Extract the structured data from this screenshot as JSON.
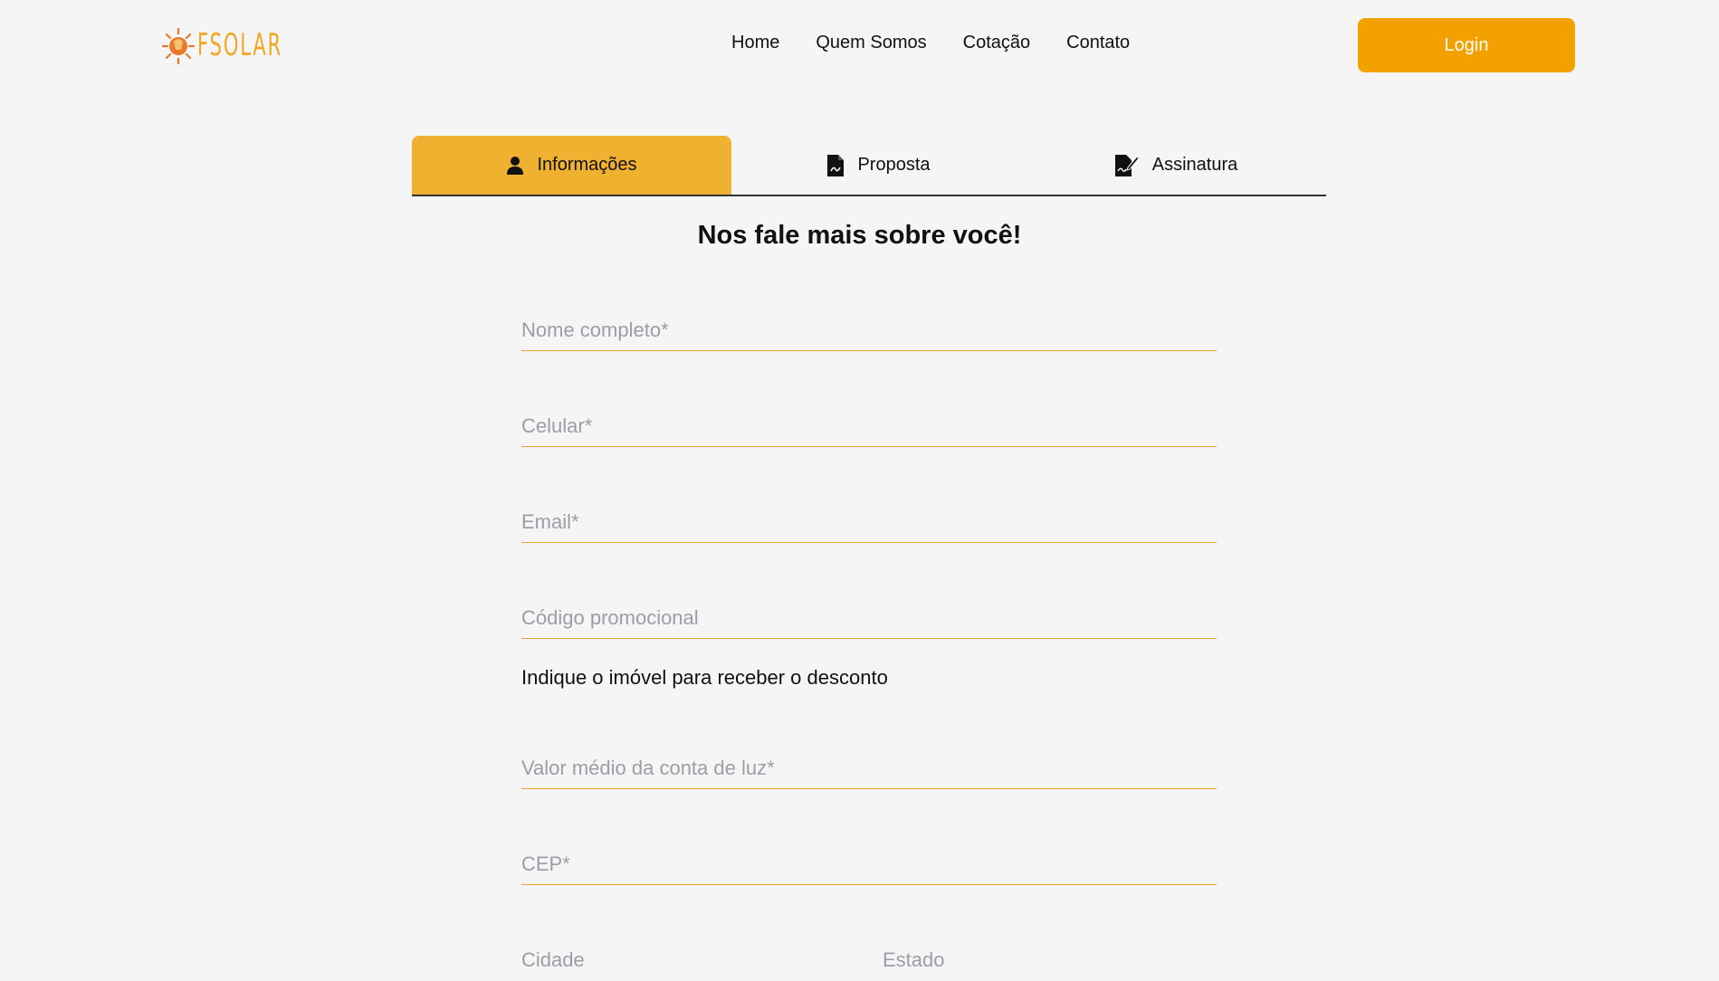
{
  "brand": {
    "logo_text": "FSOLAR",
    "accent_color": "#f2a100",
    "tab_active_color": "#f0b030"
  },
  "nav": {
    "items": [
      "Home",
      "Quem Somos",
      "Cotação",
      "Contato"
    ],
    "login_label": "Login"
  },
  "tabs": [
    {
      "label": "Informações",
      "icon": "user-icon",
      "active": true
    },
    {
      "label": "Proposta",
      "icon": "document-icon",
      "active": false
    },
    {
      "label": "Assinatura",
      "icon": "signature-icon",
      "active": false
    }
  ],
  "form": {
    "title": "Nos fale mais sobre você!",
    "fields": {
      "nome": {
        "placeholder": "Nome completo*",
        "value": ""
      },
      "celular": {
        "placeholder": "Celular*",
        "value": ""
      },
      "email": {
        "placeholder": "Email*",
        "value": ""
      },
      "codigo": {
        "placeholder": "Código promocional",
        "value": ""
      },
      "valor": {
        "placeholder": "Valor médio da conta de luz*",
        "value": ""
      },
      "cep": {
        "placeholder": "CEP*",
        "value": ""
      },
      "cidade": {
        "placeholder": "Cidade",
        "value": ""
      },
      "estado": {
        "placeholder": "Estado",
        "value": ""
      }
    },
    "promo_note": "Indique o imóvel para receber o desconto"
  }
}
